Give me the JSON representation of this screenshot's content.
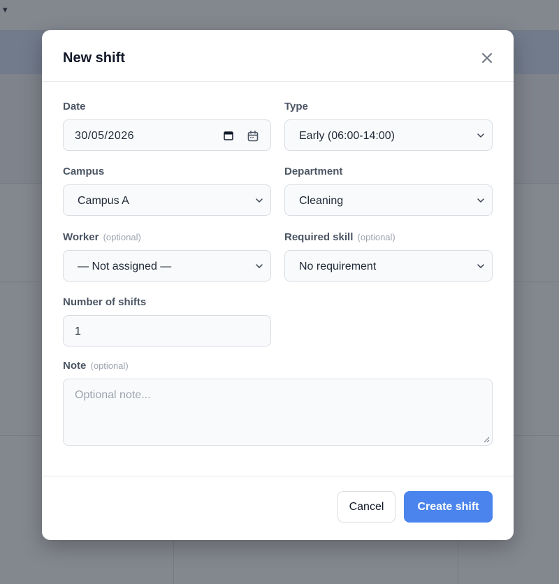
{
  "modal": {
    "title": "New shift",
    "fields": {
      "date": {
        "label": "Date",
        "value": "30/05/2026"
      },
      "type": {
        "label": "Type",
        "value": "Early (06:00-14:00)"
      },
      "campus": {
        "label": "Campus",
        "value": "Campus A"
      },
      "department": {
        "label": "Department",
        "value": "Cleaning"
      },
      "worker": {
        "label": "Worker",
        "optional": "(optional)",
        "value": "— Not assigned —"
      },
      "skill": {
        "label": "Required skill",
        "optional": "(optional)",
        "value": "No requirement"
      },
      "count": {
        "label": "Number of shifts",
        "value": "1"
      },
      "note": {
        "label": "Note",
        "optional": "(optional)",
        "placeholder": "Optional note..."
      }
    },
    "footer": {
      "cancel_label": "Cancel",
      "create_label": "Create shift"
    }
  },
  "colors": {
    "primary": "#4a84ec",
    "overlay": "rgba(17,24,39,0.52)",
    "label": "#4b5563",
    "muted": "#9ca3af"
  },
  "icons": {
    "close": "close-icon",
    "chevron": "chevron-down-icon",
    "calendar": "calendar-icon"
  }
}
